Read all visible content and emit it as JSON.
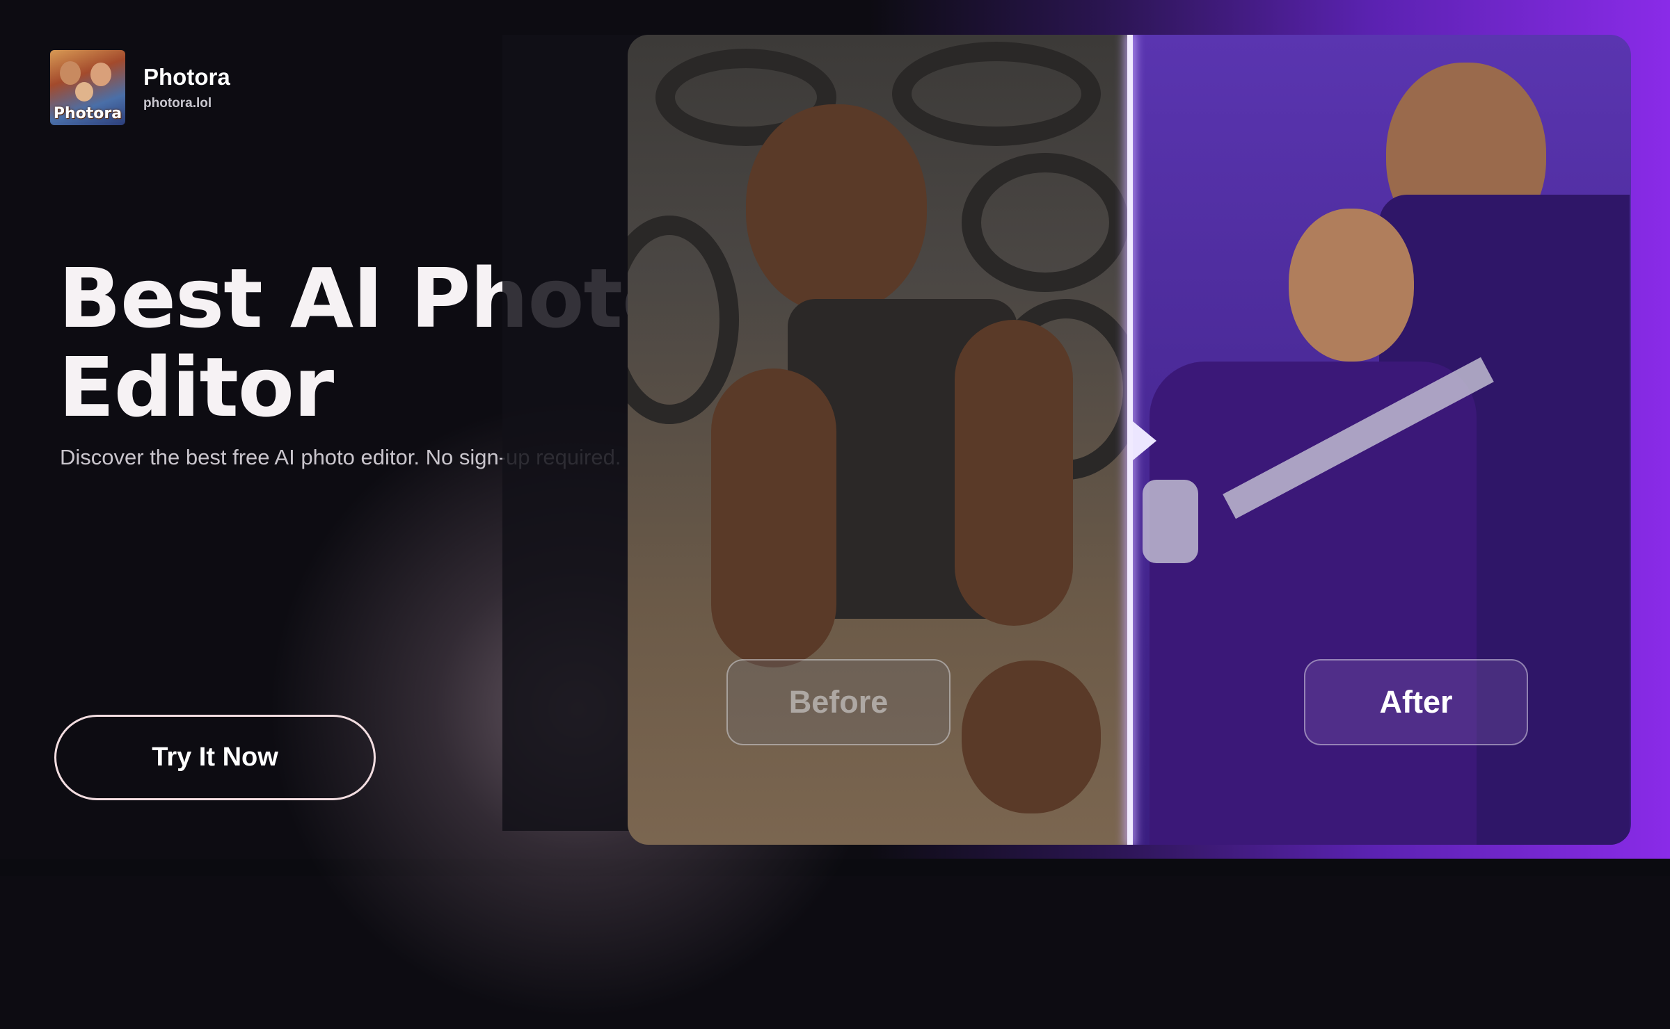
{
  "brand": {
    "name": "Photora",
    "url": "photora.lol",
    "logo_text": "Photora"
  },
  "hero": {
    "title_line1": "Best AI Photo",
    "title_line2": "Editor",
    "subtitle": "Discover the best free AI photo editor. No sign-up required.",
    "cta_label": "Try It Now"
  },
  "compare": {
    "before_label": "Before",
    "after_label": "After"
  },
  "colors": {
    "background": "#0d0c12",
    "accent_purple": "#8a2be8",
    "headline": "#f6f2f4",
    "cta_border": "#f2dde0"
  }
}
